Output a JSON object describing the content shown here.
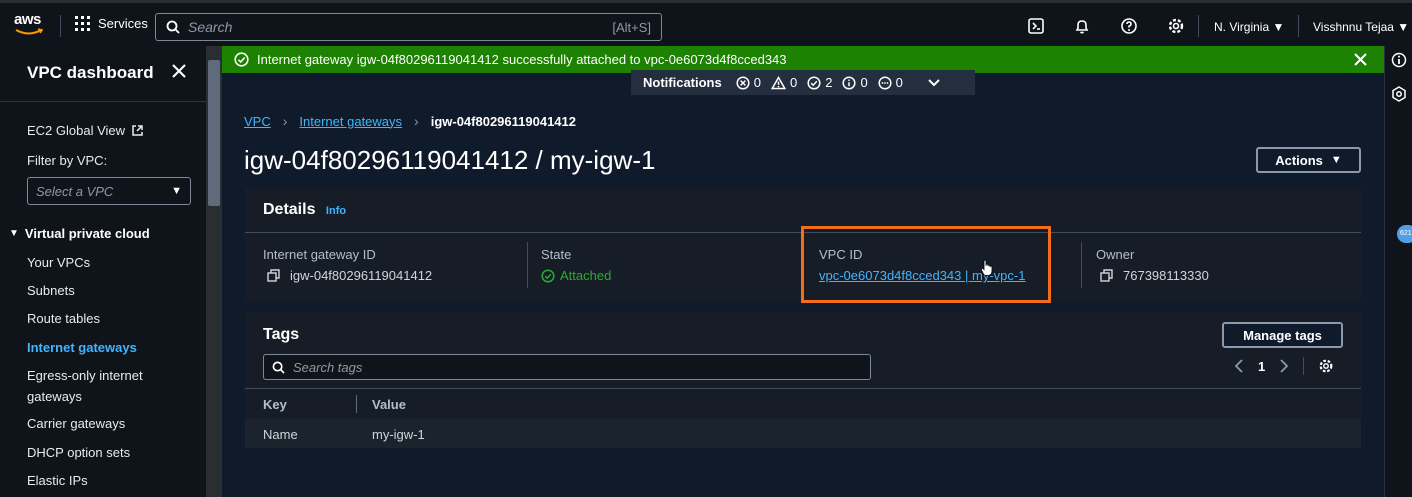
{
  "nav": {
    "logo": "aws",
    "services": "Services",
    "search_placeholder": "Search",
    "search_shortcut": "[Alt+S]",
    "region": "N. Virginia",
    "user": "Visshnnu Tejaa"
  },
  "sidebar": {
    "title": "VPC dashboard",
    "ec2_global_view": "EC2 Global View",
    "filter_label": "Filter by VPC:",
    "filter_placeholder": "Select a VPC",
    "section": "Virtual private cloud",
    "items": [
      {
        "label": "Your VPCs"
      },
      {
        "label": "Subnets"
      },
      {
        "label": "Route tables"
      },
      {
        "label": "Internet gateways"
      },
      {
        "label": "Egress-only internet"
      },
      {
        "label": "gateways"
      },
      {
        "label": "Carrier gateways"
      },
      {
        "label": "DHCP option sets"
      },
      {
        "label": "Elastic IPs"
      }
    ]
  },
  "flash": {
    "message": "Internet gateway igw-04f80296119041412 successfully attached to vpc-0e6073d4f8cced343",
    "color": "#1d8102"
  },
  "notifications": {
    "label": "Notifications",
    "error": "0",
    "warning": "0",
    "success": "2",
    "info": "0",
    "in_progress": "0"
  },
  "breadcrumb": {
    "root": "VPC",
    "parent": "Internet gateways",
    "current": "igw-04f80296119041412"
  },
  "page": {
    "title": "igw-04f80296119041412 / my-igw-1",
    "actions": "Actions"
  },
  "details": {
    "heading": "Details",
    "info": "Info",
    "igw_label": "Internet gateway ID",
    "igw_value": "igw-04f80296119041412",
    "state_label": "State",
    "state_value": "Attached",
    "vpc_label": "VPC ID",
    "vpc_value": "vpc-0e6073d4f8cced343 | my-vpc-1",
    "owner_label": "Owner",
    "owner_value": "767398113330"
  },
  "tags": {
    "heading": "Tags",
    "manage": "Manage tags",
    "search_placeholder": "Search tags",
    "page": "1",
    "columns": [
      "Key",
      "Value"
    ],
    "rows": [
      {
        "key": "Name",
        "value": "my-igw-1"
      }
    ]
  },
  "rail": {
    "badge": "621"
  }
}
